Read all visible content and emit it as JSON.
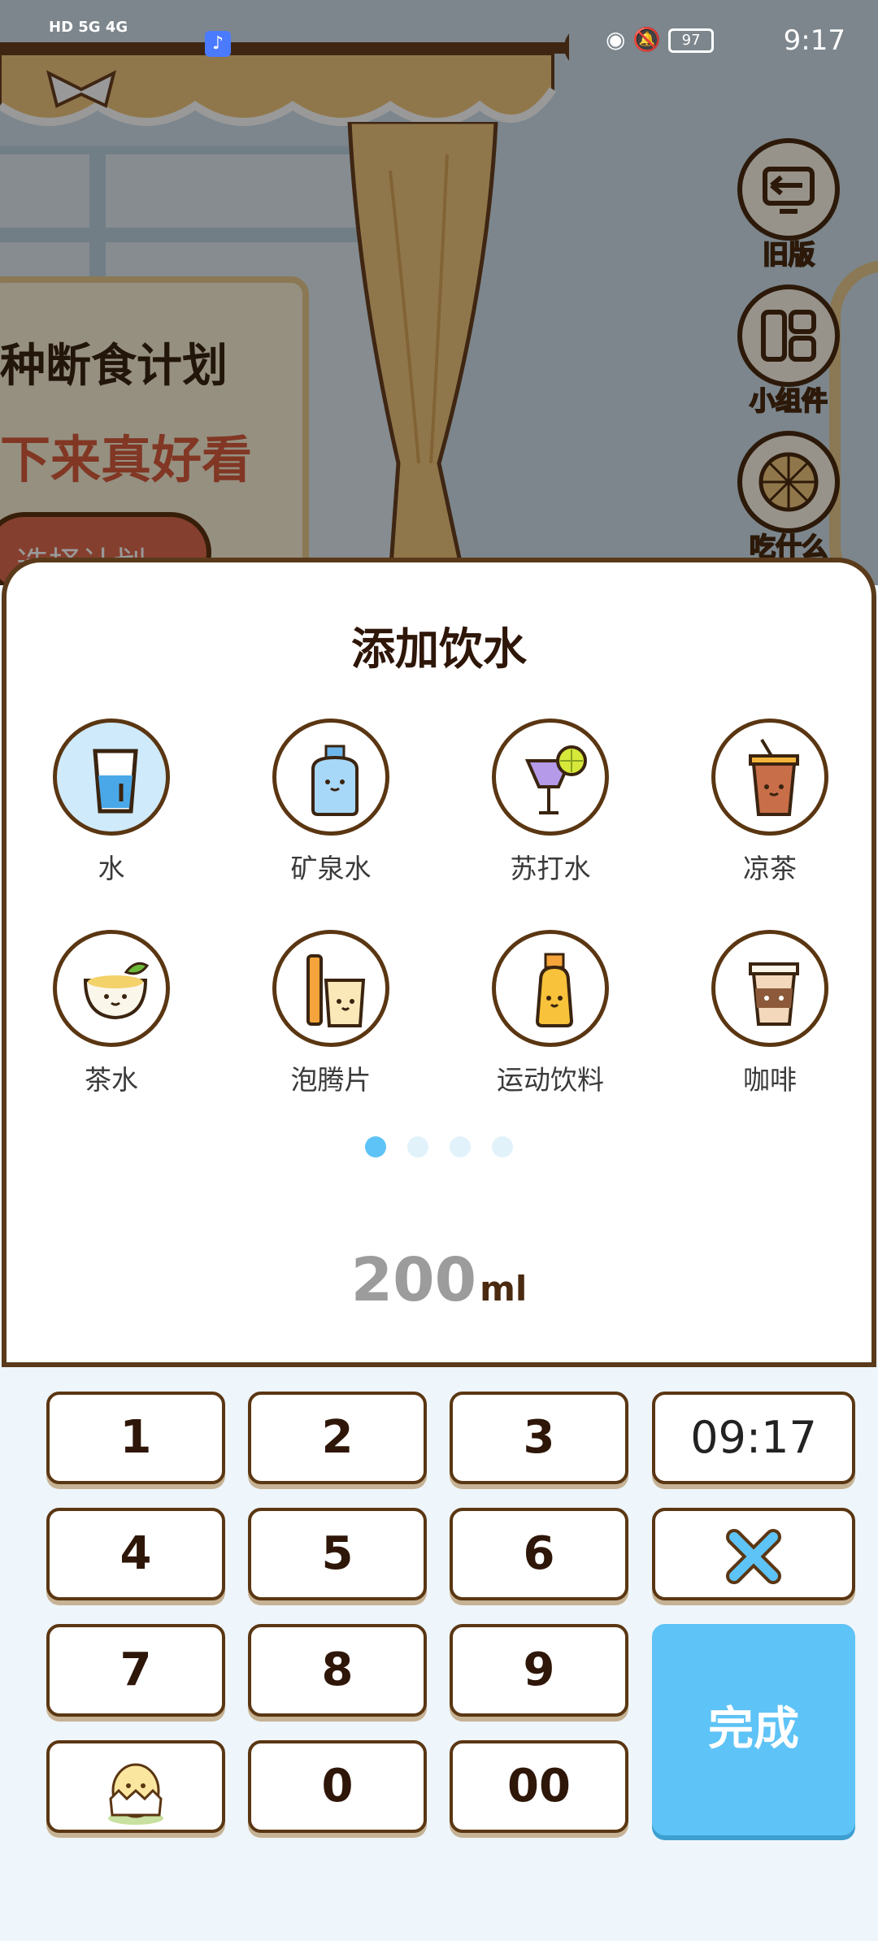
{
  "status_bar": {
    "network": "HD 5G 4G",
    "time": "9:17",
    "battery": "97"
  },
  "background": {
    "plan_title": "种断食计划",
    "plan_subtitle": "下来真好看",
    "plan_button": "选择计划",
    "side_buttons": [
      {
        "label": "旧版",
        "icon": "back-screen-icon"
      },
      {
        "label": "小组件",
        "icon": "widget-icon"
      },
      {
        "label": "吃什么",
        "icon": "wheel-icon"
      }
    ]
  },
  "sheet": {
    "title": "添加饮水",
    "drinks": [
      {
        "name": "水",
        "icon": "water-glass-icon",
        "selected": true
      },
      {
        "name": "矿泉水",
        "icon": "mineral-water-bottle-icon",
        "selected": false
      },
      {
        "name": "苏打水",
        "icon": "soda-glass-icon",
        "selected": false
      },
      {
        "name": "凉茶",
        "icon": "iced-tea-cup-icon",
        "selected": false
      },
      {
        "name": "茶水",
        "icon": "tea-bowl-icon",
        "selected": false
      },
      {
        "name": "泡腾片",
        "icon": "effervescent-tablet-icon",
        "selected": false
      },
      {
        "name": "运动饮料",
        "icon": "sports-drink-bottle-icon",
        "selected": false
      },
      {
        "name": "咖啡",
        "icon": "coffee-cup-icon",
        "selected": false
      }
    ],
    "page_count": 4,
    "active_page": 1,
    "amount": "200",
    "unit": "ml"
  },
  "keypad": {
    "keys": [
      "1",
      "2",
      "3",
      "4",
      "5",
      "6",
      "7",
      "8",
      "9",
      "0",
      "00"
    ],
    "time": "09:17",
    "delete_icon": "close-x-icon",
    "mascot_icon": "egg-mascot-icon",
    "done_label": "完成"
  },
  "colors": {
    "accent_blue": "#5ec3f6",
    "outline_brown": "#5a3612",
    "plan_red": "#d85c3c"
  }
}
